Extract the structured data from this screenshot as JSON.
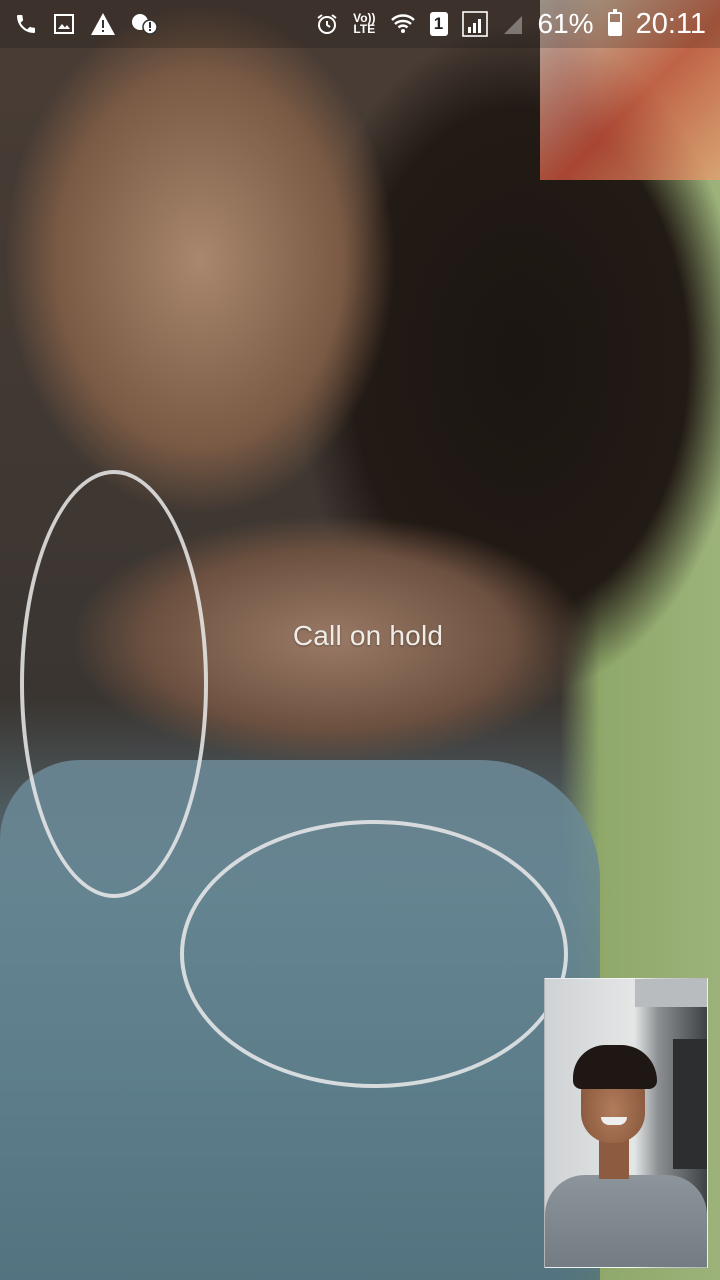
{
  "status_bar": {
    "left_icons": [
      "phone-icon",
      "image-icon",
      "warning-icon",
      "chat-alert-icon"
    ],
    "right_icons": [
      "alarm-icon",
      "volte-icon",
      "wifi-icon",
      "sim-icon",
      "signal-icon",
      "signal-empty-icon",
      "battery-icon"
    ],
    "volte_line1": "Vo))",
    "volte_line2": "LTE",
    "sim_number": "1",
    "battery_percent_text": "61%",
    "battery_level": 0.61,
    "time": "20:11"
  },
  "call": {
    "status_text": "Call on hold"
  },
  "colors": {
    "status_text": "#ffffff",
    "hold_text": "#f0ede8"
  }
}
